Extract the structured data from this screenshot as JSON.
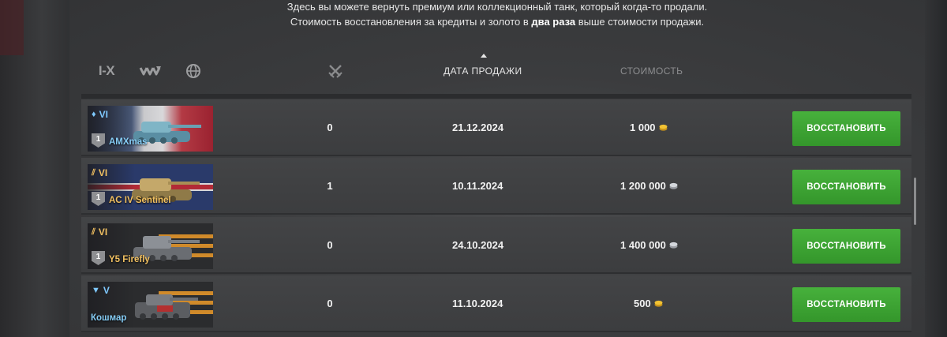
{
  "intro": {
    "line1": "Здесь вы можете вернуть премиум или коллекционный танк, который когда-то продали.",
    "line2_pre": "Стоимость восстановления за кредиты и золото в ",
    "line2_bold": "два раза",
    "line2_post": " выше стоимости продажи."
  },
  "header": {
    "tier_filter": "I-X",
    "date_label": "ДАТА ПРОДАЖИ",
    "cost_label": "СТОИМОСТЬ",
    "sorted_column": "date",
    "sort_direction": "ascending"
  },
  "colors": {
    "button_green": "#3ea334",
    "tier_blue": "#7fc9ff",
    "tier_gold": "#f1c061",
    "gold_coin": "#e8b623",
    "silver_coin": "#c9ccd1"
  },
  "rows": [
    {
      "tier": "VI",
      "tier_icon": "diamond-icon",
      "tier_color": "blue",
      "mastery": "1",
      "name": "AMXmas",
      "flag": "france",
      "battles": "0",
      "date": "21.12.2024",
      "cost": "1 000",
      "currency": "gold",
      "button": "ВОССТАНОВИТЬ"
    },
    {
      "tier": "VI",
      "tier_icon": "chevrons-icon",
      "tier_color": "gold",
      "mastery": "1",
      "name": "AC IV Sentinel",
      "flag": "uk",
      "battles": "1",
      "date": "10.11.2024",
      "cost": "1 200 000",
      "currency": "credits",
      "button": "ВОССТАНОВИТЬ"
    },
    {
      "tier": "VI",
      "tier_icon": "chevrons-icon",
      "tier_color": "gold",
      "mastery": "1",
      "name": "Y5 Firefly",
      "flag": "ribbon",
      "battles": "0",
      "date": "24.10.2024",
      "cost": "1 400 000",
      "currency": "credits",
      "button": "ВОССТАНОВИТЬ"
    },
    {
      "tier": "V",
      "tier_icon": "triangle-down-icon",
      "tier_color": "blue",
      "mastery": "",
      "name": "Кошмар",
      "flag": "ribbon",
      "battles": "0",
      "date": "11.10.2024",
      "cost": "500",
      "currency": "gold",
      "button": "ВОССТАНОВИТЬ"
    }
  ]
}
